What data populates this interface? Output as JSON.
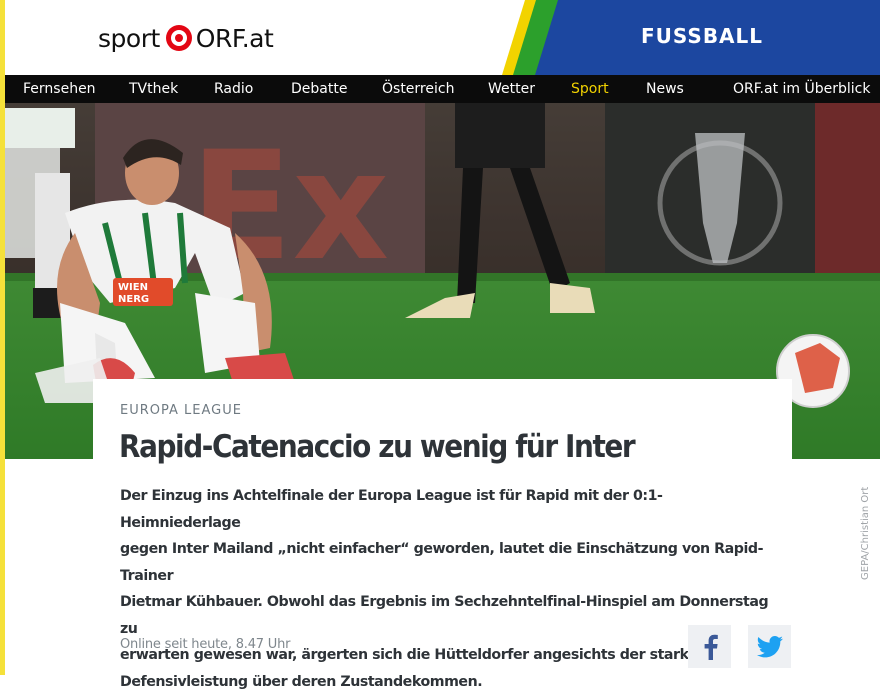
{
  "brand": {
    "logo_left": "sport",
    "logo_right": "ORF.at",
    "logo_color": "#e30613",
    "section": "FUSSBALL",
    "band_colors": [
      "#2ca02c",
      "#1c47a0",
      "#f2d300"
    ]
  },
  "nav": {
    "items": [
      {
        "label": "Fernsehen",
        "active": false
      },
      {
        "label": "TVthek",
        "active": false
      },
      {
        "label": "Radio",
        "active": false
      },
      {
        "label": "Debatte",
        "active": false
      },
      {
        "label": "Österreich",
        "active": false
      },
      {
        "label": "Wetter",
        "active": false
      },
      {
        "label": "Sport",
        "active": true
      },
      {
        "label": "News",
        "active": false
      },
      {
        "label": "ORF.at im Überblick",
        "active": false
      }
    ],
    "active_color": "#f2d300"
  },
  "hero": {
    "jersey_sponsor_line1": "WIEN",
    "jersey_sponsor_line2": "NERG",
    "billboard_text": "Ex"
  },
  "article": {
    "kicker": "EUROPA LEAGUE",
    "headline": "Rapid-Catenaccio zu wenig für Inter",
    "lead_lines": [
      "Der Einzug ins Achtelfinale der Europa League ist für Rapid mit der 0:1-Heimniederlage",
      "gegen Inter Mailand „nicht einfacher“ geworden, lautet die Einschätzung von Rapid-Trainer",
      "Dietmar Kühbauer. Obwohl das Ergebnis im Sechzehntelfinal-Hinspiel am Donnerstag zu",
      "erwarten gewesen war, ärgerten sich die Hütteldorfer angesichts der starken",
      "Defensivleistung über deren Zustandekommen."
    ],
    "dateline": "Online seit heute, 8.47 Uhr",
    "share": {
      "facebook_icon": "facebook-icon",
      "twitter_icon": "twitter-icon"
    }
  },
  "photo_credit": "GEPA/Christian Ort"
}
